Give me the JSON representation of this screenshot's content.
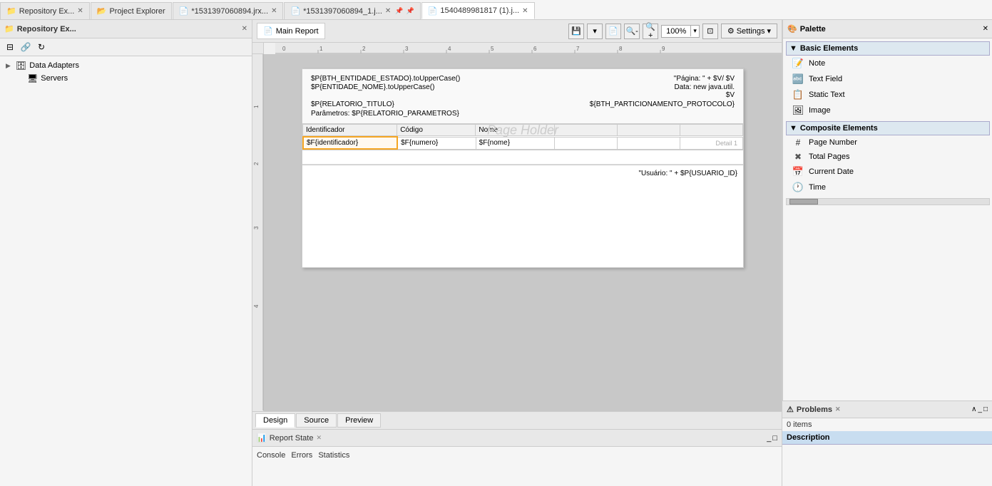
{
  "app": {
    "title": "Repository Ex..."
  },
  "tabs": [
    {
      "id": "repo-ex",
      "label": "Repository Ex...",
      "icon": "📁",
      "closable": true,
      "active": false
    },
    {
      "id": "project-explorer",
      "label": "Project Explorer",
      "icon": "📂",
      "closable": false,
      "active": false
    },
    {
      "id": "jrx1",
      "label": "*1531397060894.jrx...",
      "icon": "📄",
      "closable": true,
      "active": false
    },
    {
      "id": "jrx2",
      "label": "*1531397060894_1.j...",
      "icon": "📄",
      "closable": true,
      "active": false
    },
    {
      "id": "jrx3",
      "label": "1540489981817 (1).j...",
      "icon": "📄",
      "closable": true,
      "active": true
    }
  ],
  "left_panel": {
    "title": "Repository Ex...",
    "nodes": [
      {
        "label": "Data Adapters",
        "icon": "🗄",
        "expanded": true,
        "level": 0
      },
      {
        "label": "Servers",
        "icon": "🖥",
        "expanded": false,
        "level": 0
      }
    ]
  },
  "center": {
    "main_report_label": "Main Report",
    "zoom": "100%",
    "settings_label": "Settings",
    "report": {
      "header": {
        "row1_left": "$P{BTH_ENTIDADE_ESTADO}.toUpperCase()",
        "row1_right": "\"Página: \" + $V/ $V",
        "row2_left": "$P{ENTIDADE_NOME}.toUpperCase()",
        "row2_right_1": "Data: new java.util.",
        "row2_right_2": "$V",
        "row3_left": "$P{RELATORIO_TITULO}",
        "row3_right": "${BTH_PARTICIONAMENTO_PROTOCOLO}",
        "row4": "Parâmetros: $P{RELATORIO_PARAMETROS}"
      },
      "columns": [
        "Identificador",
        "Código",
        "Nome"
      ],
      "detail_row": {
        "col1": "$F{identificador}",
        "col2": "$F{numero}",
        "col3": "$F{nome}"
      },
      "detail_label": "Detail 1",
      "page_holder_text": "Page Holder",
      "footer": {
        "text": "\"Usuário: \" + $P{USUARIO_ID}"
      }
    }
  },
  "design_tabs": [
    {
      "label": "Design",
      "active": true
    },
    {
      "label": "Source",
      "active": false
    },
    {
      "label": "Preview",
      "active": false
    }
  ],
  "report_state": {
    "title": "Report State",
    "tabs": [
      {
        "label": "Console"
      },
      {
        "label": "Errors"
      },
      {
        "label": "Statistics"
      }
    ]
  },
  "palette": {
    "title": "Palette",
    "sections": [
      {
        "label": "Basic Elements",
        "items": [
          {
            "label": "Note",
            "icon": "📝"
          },
          {
            "label": "Text Field",
            "icon": "🔤"
          },
          {
            "label": "Static Text",
            "icon": "📋"
          },
          {
            "label": "Image",
            "icon": "🖼"
          }
        ]
      },
      {
        "label": "Composite Elements",
        "items": [
          {
            "label": "Page Number",
            "icon": "#"
          },
          {
            "label": "Total Pages",
            "icon": "✖"
          },
          {
            "label": "Current Date",
            "icon": "📅"
          },
          {
            "label": "Time",
            "icon": "🕐"
          }
        ]
      }
    ]
  },
  "problems": {
    "title": "Problems",
    "count": "0 items",
    "description_header": "Description"
  }
}
